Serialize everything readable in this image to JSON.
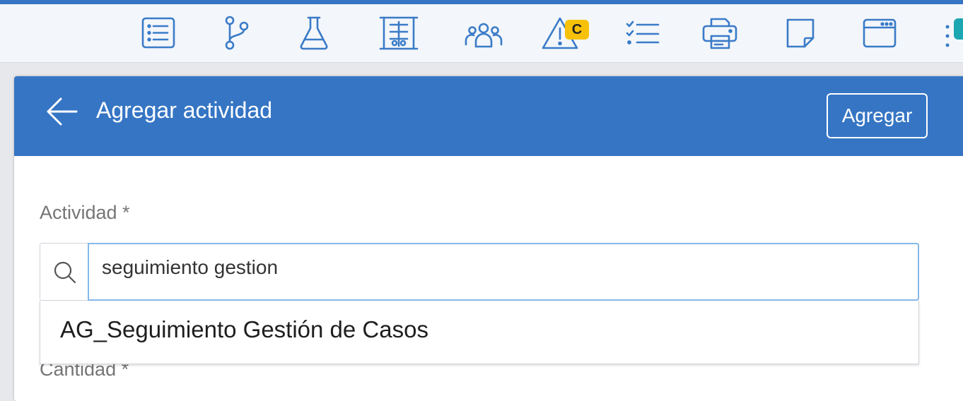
{
  "toolbar": {
    "icons": [
      "list-icon",
      "branch-icon",
      "flask-icon",
      "chart-board-icon",
      "team-icon",
      "warning-icon",
      "checklist-icon",
      "printer-icon",
      "note-icon",
      "window-icon"
    ],
    "warning_badge": "C",
    "more_icon": "more-vertical-icon"
  },
  "panel": {
    "title": "Agregar actividad",
    "back_icon": "arrow-left-icon",
    "add_button": "Agregar"
  },
  "form": {
    "activity_label": "Actividad *",
    "search_value": "seguimiento gestion",
    "search_icon": "search-icon",
    "suggestions": [
      "AG_Seguimiento Gestión de Casos"
    ],
    "quantity_label": "Cantidad *"
  },
  "colors": {
    "accent": "#3575c4",
    "badge": "#f7c10a",
    "icon": "#3a7bc8",
    "teal": "#1ba6b2"
  }
}
